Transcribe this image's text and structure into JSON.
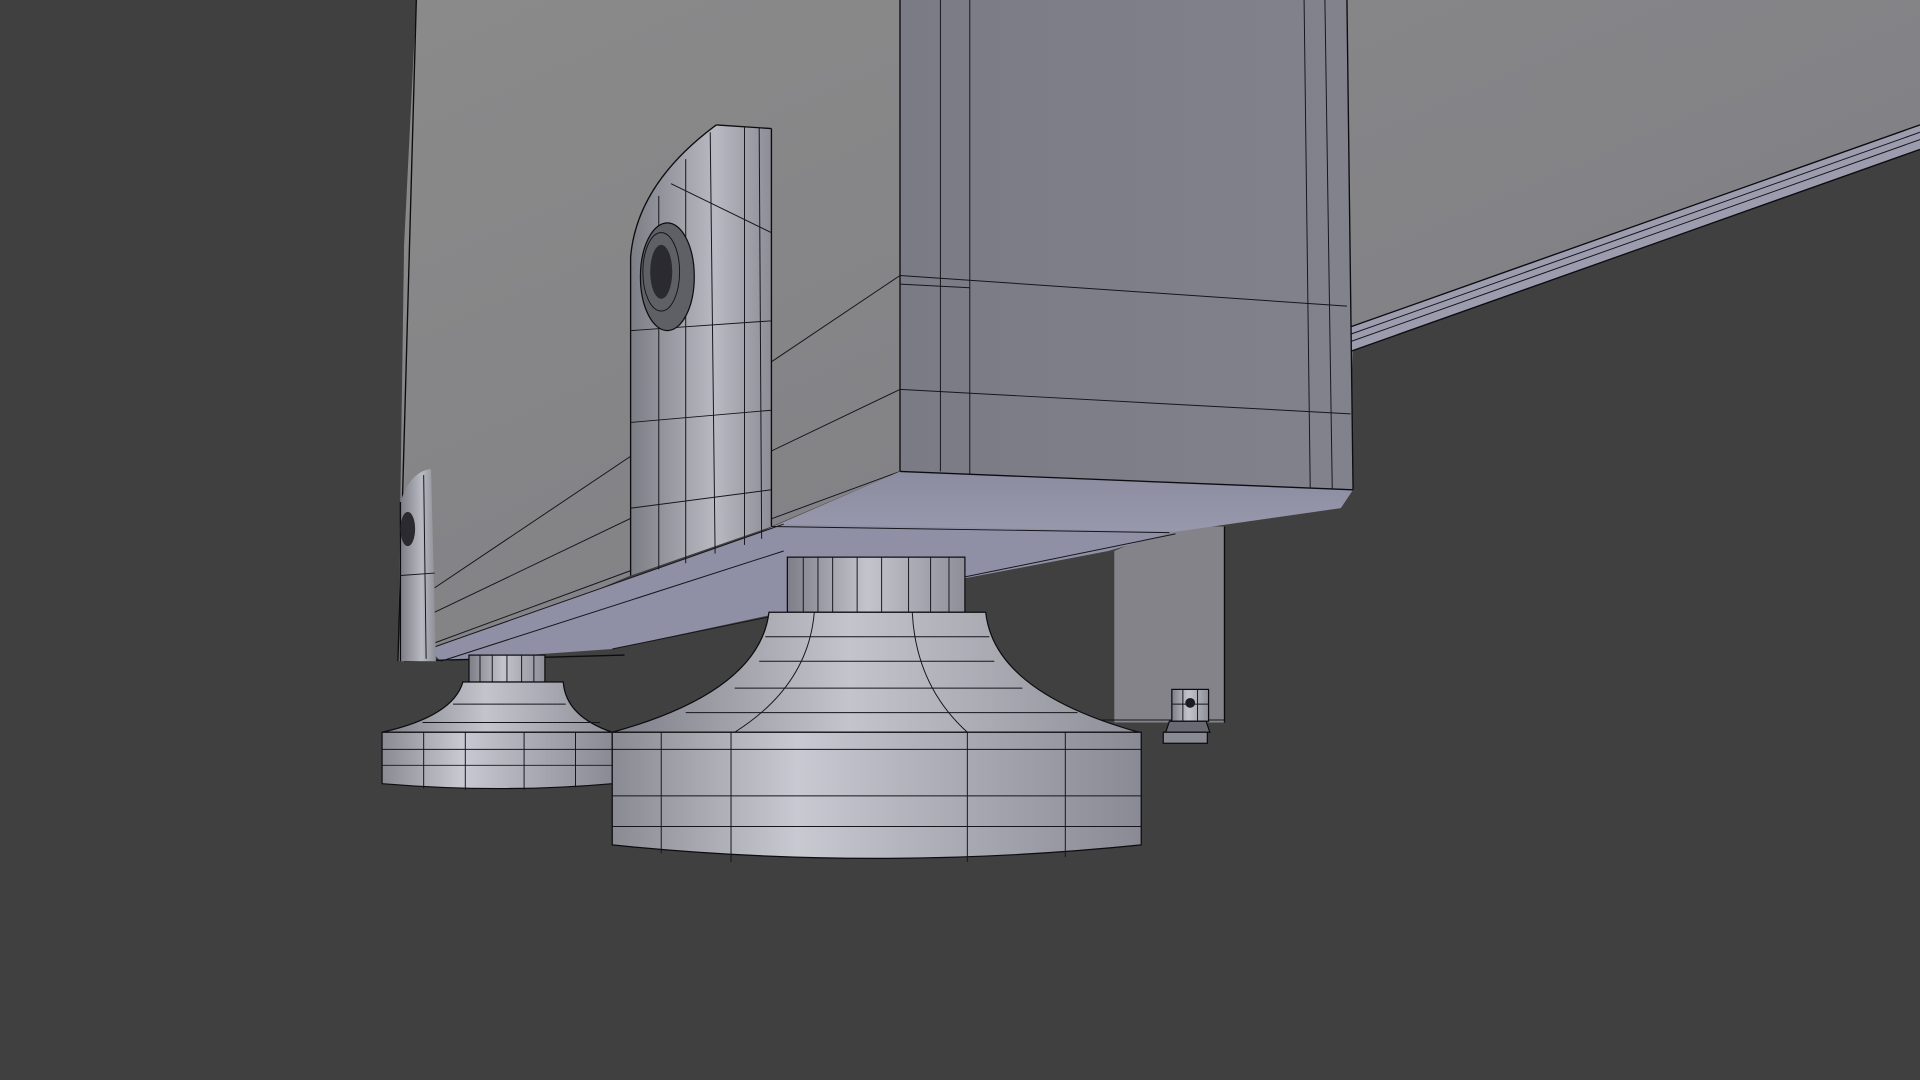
{
  "viewport": {
    "shading": "solid-wireframe",
    "background_color": "#404040",
    "mesh_color": "#86868f",
    "wire_color": "#0c0c10"
  },
  "objects": [
    {
      "name": "cabinet-wall",
      "icon": "mesh-panel"
    },
    {
      "name": "cabinet-box",
      "icon": "mesh-box"
    },
    {
      "name": "mounting-bracket",
      "icon": "mesh-bracket"
    },
    {
      "name": "leveling-foot-large",
      "icon": "mesh-cylinder"
    },
    {
      "name": "leveling-foot-small",
      "icon": "mesh-cylinder"
    },
    {
      "name": "leveling-foot-tiny",
      "icon": "mesh-cylinder"
    },
    {
      "name": "base-rail",
      "icon": "mesh-rail"
    }
  ]
}
